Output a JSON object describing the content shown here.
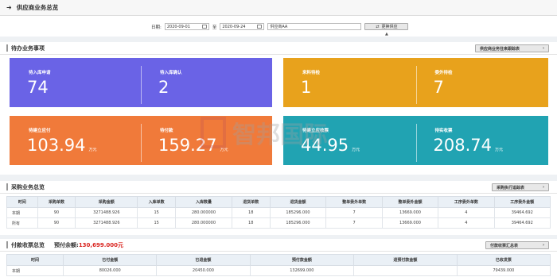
{
  "header": {
    "title": "供应商业务总览"
  },
  "filter": {
    "date_label": "日期:",
    "date_from": "2020-09-01",
    "to_label": "至",
    "date_to": "2020-09-24",
    "supplier": "供应商AA",
    "switch_button": "更换供应"
  },
  "pending": {
    "title": "待办业务事项",
    "button": "供应商业务往来跟踪表",
    "cards": [
      {
        "label": "待入库申请",
        "value": "74",
        "unit": "",
        "color": "#6a63e6"
      },
      {
        "label": "待入库确认",
        "value": "2",
        "unit": "",
        "color": "#6a63e6"
      },
      {
        "label": "来料待检",
        "value": "1",
        "unit": "",
        "color": "#e8a21c"
      },
      {
        "label": "委外待检",
        "value": "7",
        "unit": "",
        "color": "#e8a21c"
      },
      {
        "label": "待建立应付",
        "value": "103.94",
        "unit": "万元",
        "color": "#f07a3a"
      },
      {
        "label": "待付款",
        "value": "159.27",
        "unit": "万元",
        "color": "#f07a3a"
      },
      {
        "label": "待建立应收票",
        "value": "44.95",
        "unit": "万元",
        "color": "#21a3b2"
      },
      {
        "label": "待实收票",
        "value": "208.74",
        "unit": "万元",
        "color": "#21a3b2"
      }
    ]
  },
  "watermark": {
    "text": "智邦国际"
  },
  "purchase": {
    "title": "采购业务总览",
    "button": "采购执行追踪表",
    "columns": [
      "时间",
      "采购单数",
      "采购金额",
      "入库单数",
      "入库数量",
      "退货单数",
      "退货金额",
      "整单委外单数",
      "整单委外金额",
      "工序委外单数",
      "工序委外金额"
    ],
    "rows": [
      [
        "本期",
        "90",
        "3271488.926",
        "15",
        "280.000000",
        "18",
        "185296.000",
        "7",
        "13669.000",
        "4",
        "39464.692"
      ],
      [
        "所有",
        "90",
        "3271488.926",
        "15",
        "280.000000",
        "18",
        "185296.000",
        "7",
        "13669.000",
        "4",
        "39464.692"
      ]
    ]
  },
  "payment": {
    "title": "付款收票总览",
    "prepay_label": "预付余额:",
    "prepay_value": "130,699.000元",
    "button": "付款收票汇总表",
    "columns": [
      "时间",
      "已付金额",
      "已退金额",
      "预付款金额",
      "退预付款金额",
      "已收发票"
    ],
    "rows": [
      [
        "本期",
        "80026.000",
        "20450.000",
        "132699.000",
        "",
        "79439.000"
      ]
    ]
  }
}
